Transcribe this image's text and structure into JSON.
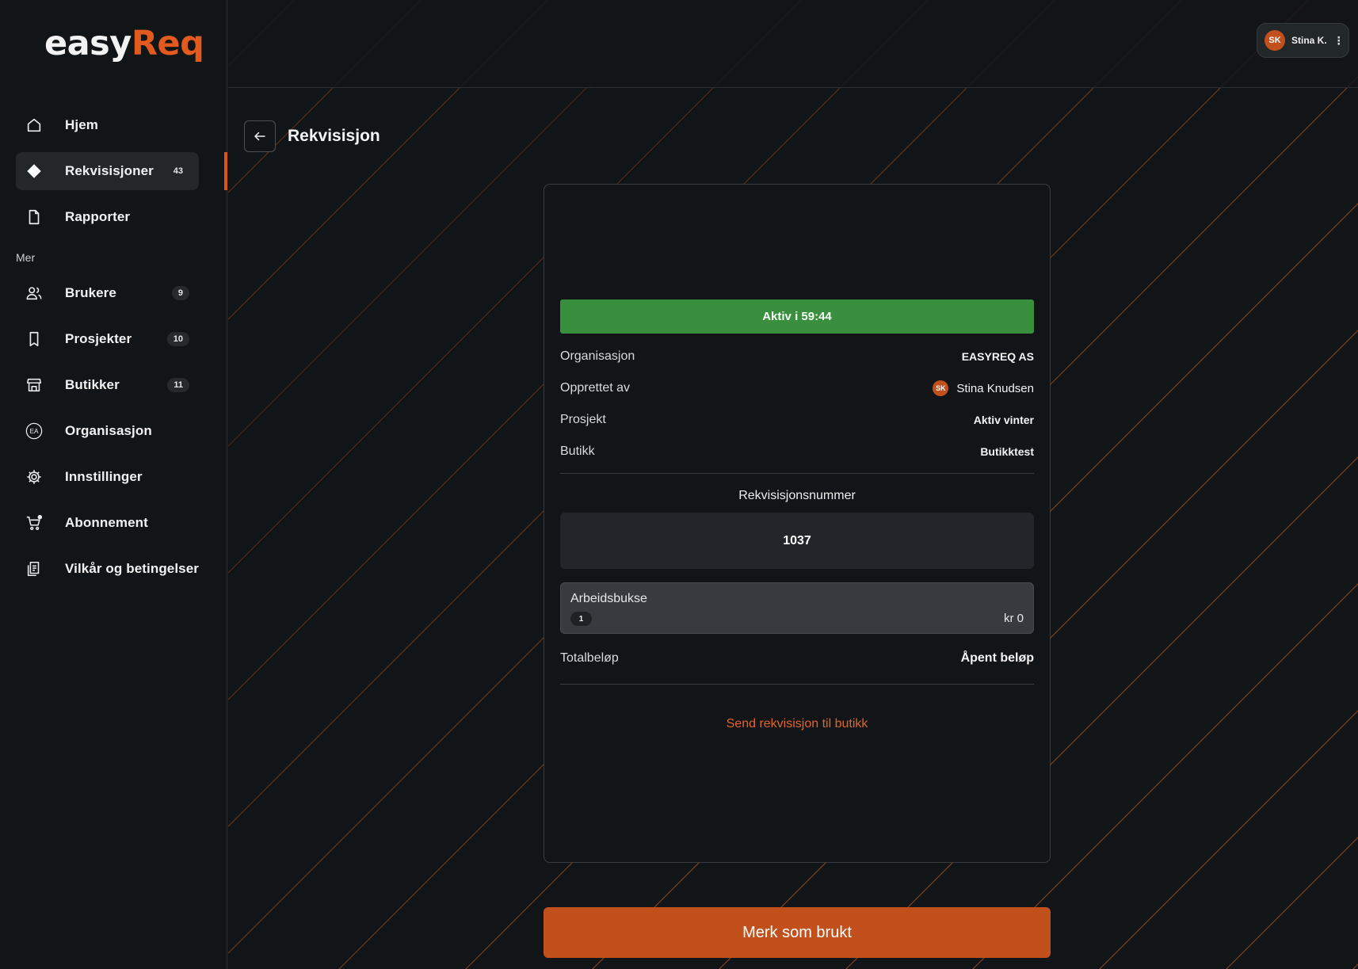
{
  "brand": {
    "part1": "easy",
    "part2": "Req"
  },
  "colors": {
    "accent": "#c2501c",
    "status_active": "#3a8f3f",
    "link": "#e36428",
    "background": "#121517"
  },
  "sidebar": {
    "primary": [
      {
        "label": "Hjem",
        "icon": "home-icon"
      },
      {
        "label": "Rekvisisjoner",
        "icon": "diamond-icon",
        "count": "43",
        "active": true
      },
      {
        "label": "Rapporter",
        "icon": "document-icon"
      }
    ],
    "section_label": "Mer",
    "secondary": [
      {
        "label": "Brukere",
        "icon": "users-icon",
        "count": "9"
      },
      {
        "label": "Prosjekter",
        "icon": "bookmark-icon",
        "count": "10"
      },
      {
        "label": "Butikker",
        "icon": "store-icon",
        "count": "11"
      },
      {
        "label": "Organisasjon",
        "icon": "org-badge-icon",
        "badge": "EA"
      },
      {
        "label": "Innstillinger",
        "icon": "gear-icon"
      },
      {
        "label": "Abonnement",
        "icon": "cart-icon"
      },
      {
        "label": "Vilkår og betingelser",
        "icon": "terms-icon"
      }
    ]
  },
  "user": {
    "initials": "SK",
    "short_name": "Stina K.",
    "menu_glyph": "⋮"
  },
  "page": {
    "title": "Rekvisisjon"
  },
  "requisition": {
    "status": "Aktiv i 59:44",
    "details": [
      {
        "key": "Organisasjon",
        "value": "EASYREQ AS"
      },
      {
        "key": "Opprettet av",
        "value": "Stina Knudsen",
        "avatar": "SK"
      },
      {
        "key": "Prosjekt",
        "value": "Aktiv vinter"
      },
      {
        "key": "Butikk",
        "value": "Butikktest"
      }
    ],
    "number_label": "Rekvisisjonsnummer",
    "number": "1037",
    "items": [
      {
        "name": "Arbeidsbukse",
        "quantity": "1",
        "price": "kr 0"
      }
    ],
    "total_label": "Totalbeløp",
    "total_value": "Åpent beløp",
    "send_link": "Send rekvisisjon til butikk",
    "primary_action": "Merk som brukt"
  }
}
